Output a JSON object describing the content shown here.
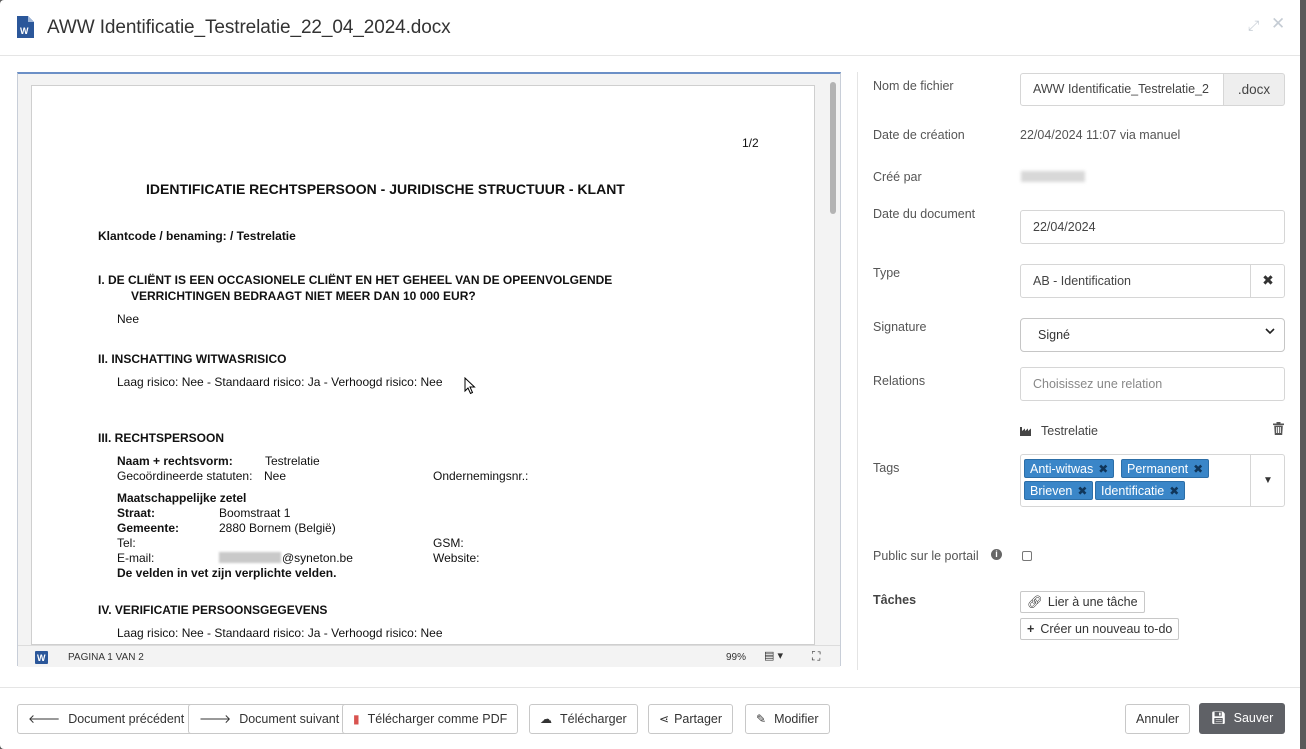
{
  "header": {
    "title": "AWW Identificatie_Testrelatie_22_04_2024.docx",
    "file_icon": "word-document-icon",
    "expand_icon": "expand-icon",
    "close_icon": "close-icon"
  },
  "document": {
    "page_number": "1/2",
    "heading": "IDENTIFICATIE RECHTSPERSOON - JURIDISCHE STRUCTUUR - KLANT",
    "client_line": "Klantcode / benaming:  / Testrelatie",
    "section1_line1": "I. DE CLIËNT IS EEN OCCASIONELE CLIËNT EN HET GEHEEL VAN DE OPEENVOLGENDE",
    "section1_line2": "VERRICHTINGEN BEDRAAGT NIET MEER DAN 10 000 EUR?",
    "section1_answer": "Nee",
    "section2_title": "II. INSCHATTING WITWASRISICO",
    "section2_text": "Laag risico: Nee - Standaard risico: Ja - Verhoogd risico: Nee",
    "section3_title": "III. RECHTSPERSOON",
    "name_label": "Naam + rechtsvorm:",
    "name_value": "Testrelatie",
    "statutes_label": "Gecoördineerde statuten:",
    "statutes_value": "Nee",
    "enterprise_label": "Ondernemingsnr.:",
    "seat_title": "Maatschappelijke zetel",
    "street_label": "Straat:",
    "street_value": "Boomstraat 1",
    "city_label": "Gemeente:",
    "city_value": "2880 Bornem (België)",
    "tel_label": "Tel:",
    "gsm_label": "GSM:",
    "email_label": "E-mail:",
    "email_value": "@syneton.be",
    "website_label": "Website:",
    "required_note": "De velden in vet zijn verplichte velden.",
    "section4_title": "IV. VERIFICATIE PERSOONSGEGEVENS",
    "section4_text": "Laag risico: Nee - Standaard risico: Ja - Verhoogd risico: Nee"
  },
  "statusbar": {
    "page_info": "PAGINA 1 VAN 2",
    "zoom": "99%"
  },
  "form": {
    "filename_label": "Nom de fichier",
    "filename_value": "AWW Identificatie_Testrelatie_2",
    "filename_ext": ".docx",
    "created_date_label": "Date de création",
    "created_date_value": "22/04/2024 11:07 via manuel",
    "created_by_label": "Créé par",
    "document_date_label": "Date du document",
    "document_date_value": "22/04/2024",
    "type_label": "Type",
    "type_value": "AB - Identification",
    "signature_label": "Signature",
    "signature_value": "Signé",
    "relations_label": "Relations",
    "relations_placeholder": "Choisissez une relation",
    "relation_item": "Testrelatie",
    "tags_label": "Tags",
    "tags": [
      "Anti-witwas",
      "Permanent",
      "Brieven",
      "Identificatie"
    ],
    "portal_label": "Public sur le portail",
    "tasks_label": "Tâches",
    "link_task": "Lier à une tâche",
    "new_todo": "Créer un nouveau to-do"
  },
  "footer": {
    "prev": "Document précédent",
    "next": "Document suivant",
    "pdf": "Télécharger comme PDF",
    "download": "Télécharger",
    "share": "Partager",
    "edit": "Modifier",
    "cancel": "Annuler",
    "save": "Sauver"
  },
  "colors": {
    "tag_bg": "#3a86c8",
    "save_bg": "#5f6166",
    "word_blue": "#2b579a",
    "pdf_red": "#d9534f"
  }
}
